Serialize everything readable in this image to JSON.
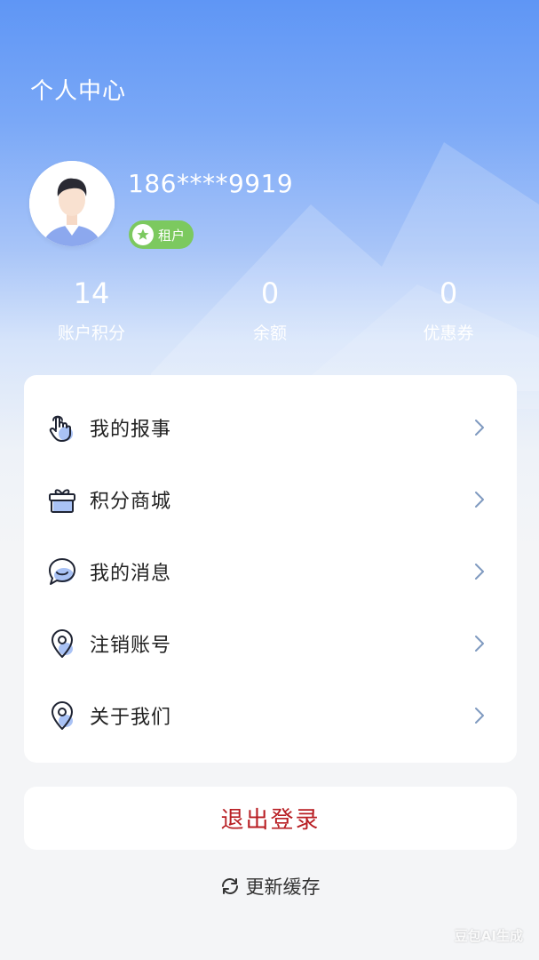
{
  "header": {
    "title": "个人中心"
  },
  "profile": {
    "phone": "186****9919",
    "role": "租户"
  },
  "stats": [
    {
      "value": "14",
      "label": "账户积分"
    },
    {
      "value": "0",
      "label": "余额"
    },
    {
      "value": "0",
      "label": "优惠券"
    }
  ],
  "menu": [
    {
      "label": "我的报事",
      "icon": "hand-tap-icon"
    },
    {
      "label": "积分商城",
      "icon": "gift-icon"
    },
    {
      "label": "我的消息",
      "icon": "chat-bubble-icon"
    },
    {
      "label": "注销账号",
      "icon": "location-pin-icon"
    },
    {
      "label": "关于我们",
      "icon": "location-pin-icon"
    }
  ],
  "logout_label": "退出登录",
  "refresh_label": "更新缓存",
  "watermark": "豆包AI生成",
  "colors": {
    "accent_blue": "#5f96f5",
    "badge_green": "#7cc95f",
    "logout_red": "#b81e23",
    "icon_blue": "#a9c2f5"
  }
}
